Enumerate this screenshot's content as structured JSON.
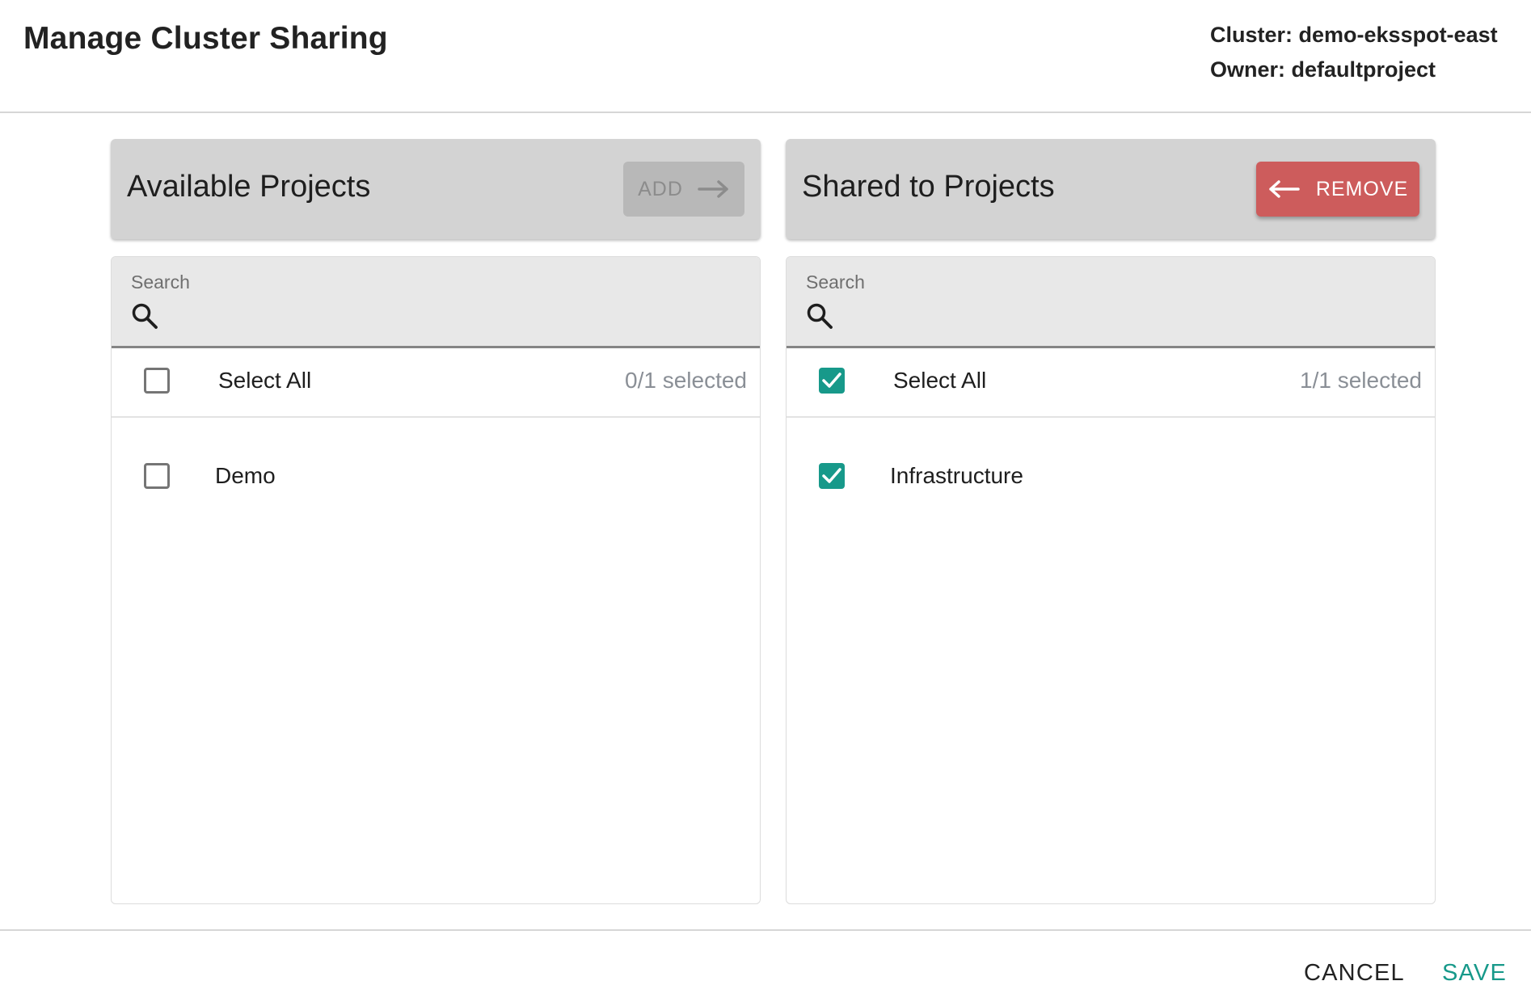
{
  "dialog": {
    "title": "Manage Cluster Sharing",
    "cluster_label": "Cluster: demo-eksspot-east",
    "owner_label": "Owner: defaultproject"
  },
  "available": {
    "title": "Available Projects",
    "action_label": "ADD",
    "action_icon": "arrow-right-icon",
    "action_enabled": false,
    "search": {
      "label": "Search",
      "value": "",
      "icon": "search-icon"
    },
    "select_all": {
      "label": "Select All",
      "checked": false,
      "count_text": "0/1 selected"
    },
    "items": [
      {
        "label": "Demo",
        "checked": false
      }
    ]
  },
  "shared": {
    "title": "Shared to Projects",
    "action_label": "REMOVE",
    "action_icon": "arrow-left-icon",
    "action_enabled": true,
    "search": {
      "label": "Search",
      "value": "",
      "icon": "search-icon"
    },
    "select_all": {
      "label": "Select All",
      "checked": true,
      "count_text": "1/1 selected"
    },
    "items": [
      {
        "label": "Infrastructure",
        "checked": true
      }
    ]
  },
  "footer": {
    "cancel_label": "CANCEL",
    "save_label": "SAVE"
  },
  "colors": {
    "accent": "#17998a",
    "danger": "#cd5c5c",
    "header_bg": "#d3d3d3",
    "search_bg": "#e8e8e8"
  }
}
